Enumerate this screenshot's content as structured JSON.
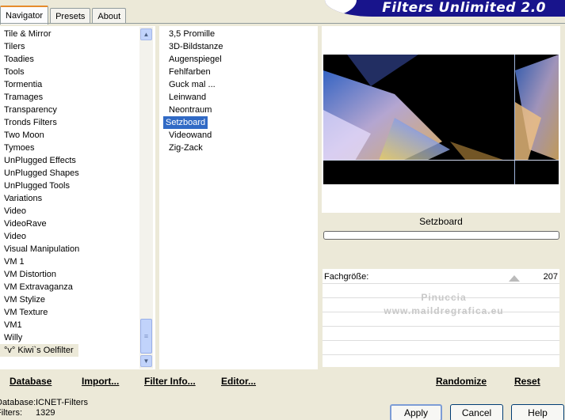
{
  "tabs": [
    {
      "label": "Navigator",
      "active": true
    },
    {
      "label": "Presets",
      "active": false
    },
    {
      "label": "About",
      "active": false
    }
  ],
  "banner": {
    "title": "Filters Unlimited 2.0"
  },
  "categories": [
    "Tile & Mirror",
    "Tilers",
    "Toadies",
    "Tools",
    "Tormentia",
    "Tramages",
    "Transparency",
    "Tronds Filters",
    "Two Moon",
    "Tymoes",
    "UnPlugged Effects",
    "UnPlugged Shapes",
    "UnPlugged Tools",
    "Variations",
    "Video",
    "VideoRave",
    "Video",
    "Visual Manipulation",
    "VM 1",
    "VM Distortion",
    "VM Extravaganza",
    "VM Stylize",
    "VM Texture",
    "VM1",
    "Willy",
    "°v° Kiwi`s Oelfilter"
  ],
  "categories_highlighted": "°v° Kiwi`s Oelfilter",
  "filters": [
    "3,5 Promille",
    "3D-Bildstanze",
    "Augenspiegel",
    "Fehlfarben",
    "Guck mal ...",
    "Leinwand",
    "Neontraum",
    "Setzboard",
    "Videowand",
    "Zig-Zack"
  ],
  "filters_selected": "Setzboard",
  "preview": {
    "filter_name": "Setzboard"
  },
  "params": [
    {
      "label": "Fachgröße:",
      "value": "207"
    }
  ],
  "watermark": {
    "line1": "Pinuccia",
    "line2": "www.maildregrafica.eu"
  },
  "bottom_links": {
    "database": "Database",
    "import": "Import...",
    "filter_info": "Filter Info...",
    "editor": "Editor...",
    "randomize": "Randomize",
    "reset": "Reset"
  },
  "status": {
    "database_label": "Database:",
    "database_value": "ICNET-Filters",
    "filters_label": "Filters:",
    "filters_value": "1329"
  },
  "buttons": {
    "apply": "Apply",
    "cancel": "Cancel",
    "help": "Help"
  }
}
